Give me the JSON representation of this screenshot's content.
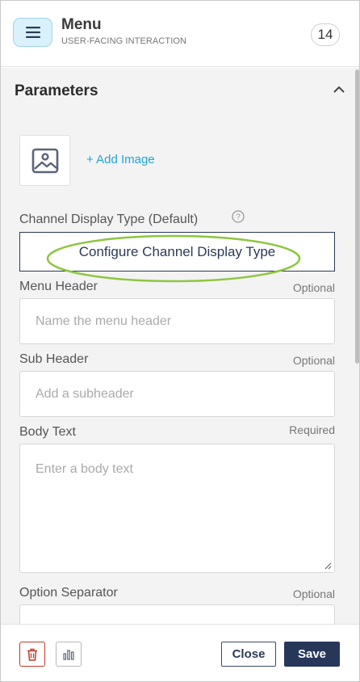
{
  "header": {
    "title": "Menu",
    "subtitle": "USER-FACING INTERACTION",
    "count": "14",
    "menu_icon": "hamburger-icon"
  },
  "parameters": {
    "title": "Parameters",
    "collapse_icon": "chevron-up-icon",
    "add_image_label": "+ Add Image",
    "image_icon": "image-icon"
  },
  "fields": {
    "channel_display": {
      "label": "Channel Display Type (Default)",
      "button_label": "Configure Channel Display Type",
      "help_icon": "question-circle-icon"
    },
    "menu_header": {
      "label": "Menu Header",
      "requirement": "Optional",
      "placeholder": "Name the menu header"
    },
    "sub_header": {
      "label": "Sub Header",
      "requirement": "Optional",
      "placeholder": "Add a subheader"
    },
    "body_text": {
      "label": "Body Text",
      "requirement": "Required",
      "placeholder": "Enter a body text"
    },
    "option_separator": {
      "label": "Option Separator",
      "requirement": "Optional"
    }
  },
  "footer": {
    "delete_icon": "trash-icon",
    "stats_icon": "bar-chart-icon",
    "close_label": "Close",
    "save_label": "Save"
  },
  "colors": {
    "accent": "#21a4d6",
    "primary": "#26375a",
    "highlight": "#8cc63f",
    "danger": "#c0392b"
  }
}
